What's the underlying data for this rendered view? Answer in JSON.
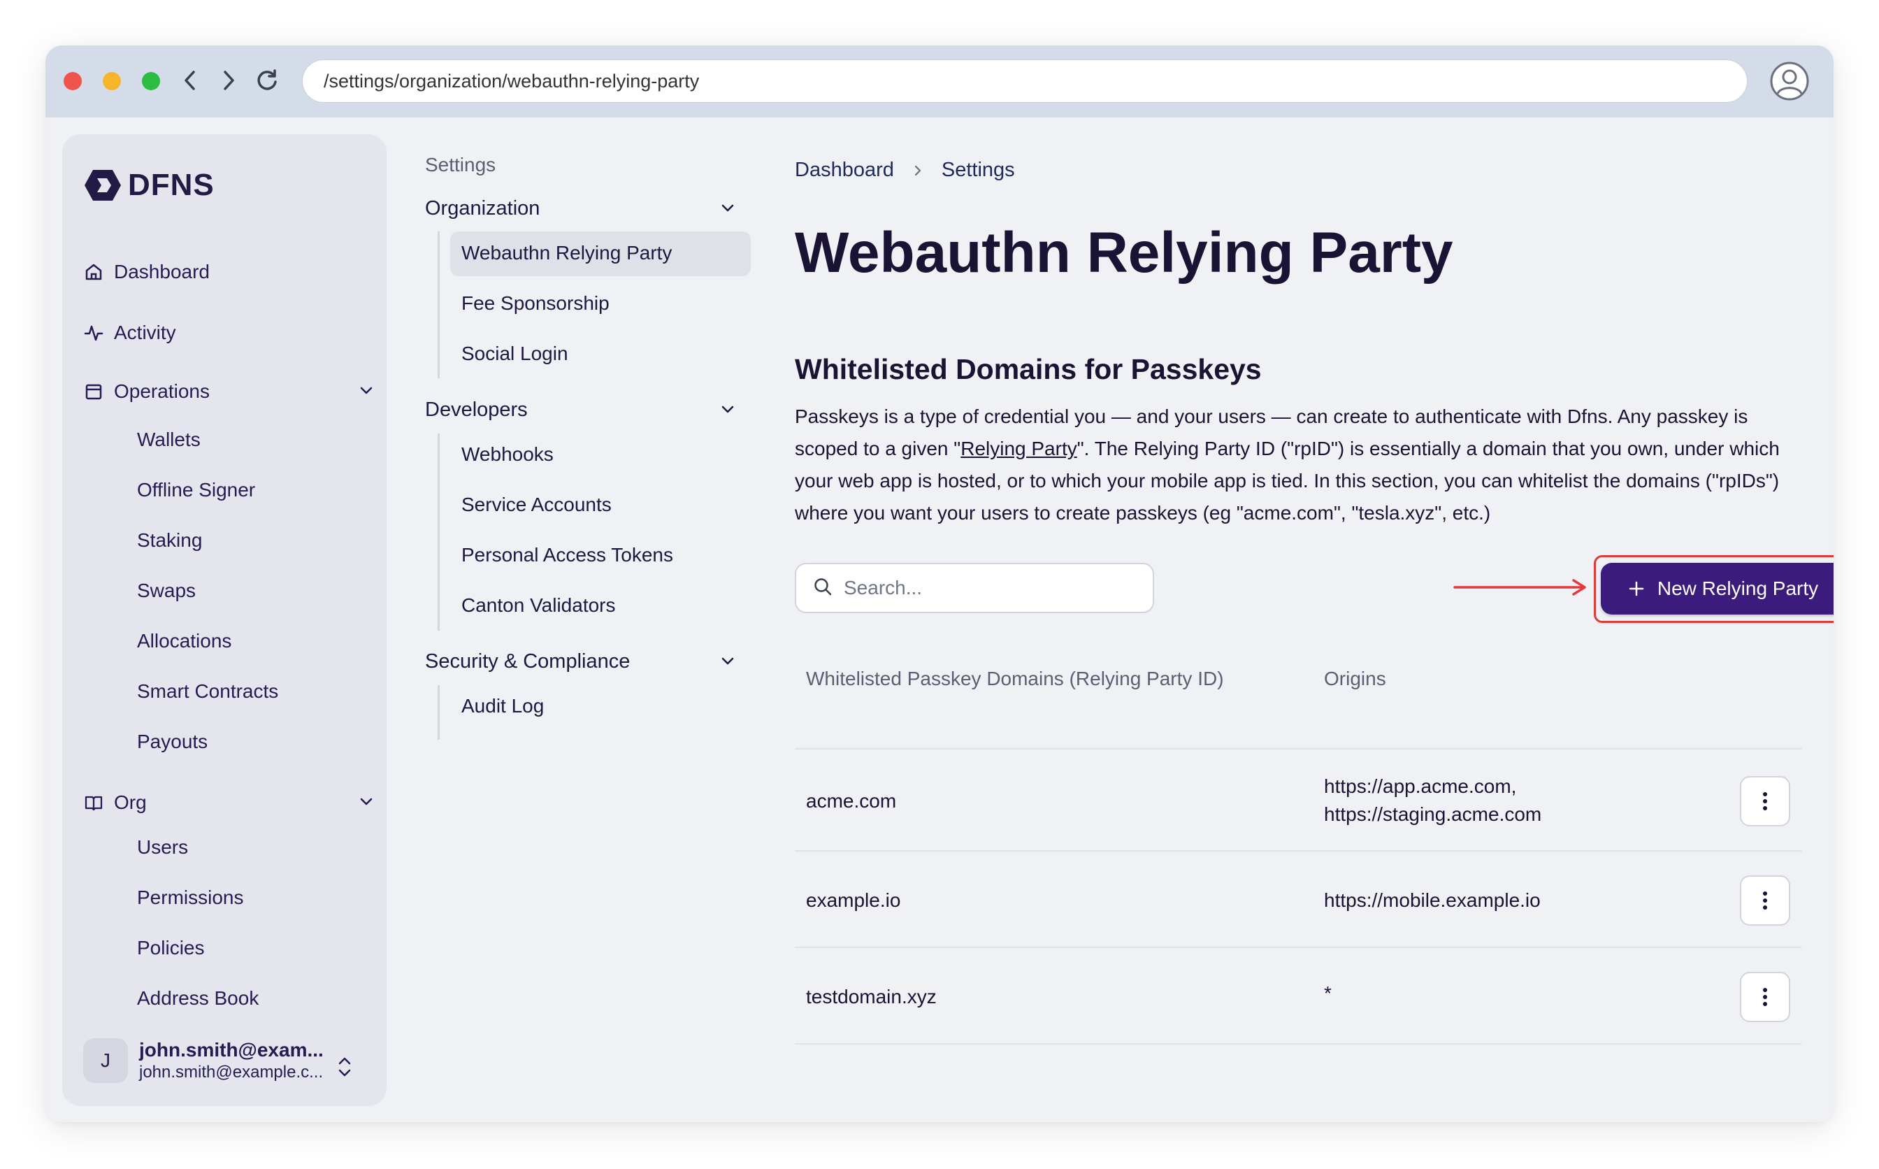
{
  "browser": {
    "url": "/settings/organization/webauthn-relying-party"
  },
  "sidebar": {
    "logo_text": "DFNS",
    "items": [
      {
        "label": "Dashboard"
      },
      {
        "label": "Activity"
      },
      {
        "label": "Operations"
      },
      {
        "label": "Org"
      }
    ],
    "operations_items": [
      "Wallets",
      "Offline Signer",
      "Staking",
      "Swaps",
      "Allocations",
      "Smart Contracts",
      "Payouts"
    ],
    "org_items": [
      "Users",
      "Permissions",
      "Policies",
      "Address Book"
    ],
    "user": {
      "initial": "J",
      "name": "john.smith@exam...",
      "email": "john.smith@example.c..."
    }
  },
  "settings_nav": {
    "title": "Settings",
    "groups": [
      {
        "label": "Organization",
        "items": [
          "Webauthn Relying Party",
          "Fee Sponsorship",
          "Social Login"
        ]
      },
      {
        "label": "Developers",
        "items": [
          "Webhooks",
          "Service Accounts",
          "Personal Access Tokens",
          "Canton Validators"
        ]
      },
      {
        "label": "Security & Compliance",
        "items": [
          "Audit Log"
        ]
      }
    ]
  },
  "main": {
    "breadcrumb": [
      "Dashboard",
      "Settings"
    ],
    "title": "Webauthn Relying Party",
    "section_title": "Whitelisted Domains for Passkeys",
    "description": {
      "part1": "Passkeys is a type of credential you — and your users — can create to authenticate with Dfns. Any passkey is scoped to a given \"",
      "link": "Relying Party",
      "part2": "\". The Relying Party ID (\"rpID\") is essentially a domain that you own, under which your web app is hosted, or to which your mobile app is tied. In this section, you can whitelist the domains (\"rpIDs\") where you want your users to create passkeys (eg \"acme.com\", \"tesla.xyz\", etc.)"
    },
    "search_placeholder": "Search...",
    "new_button_label": "New Relying Party",
    "table": {
      "columns": [
        "Whitelisted Passkey Domains (Relying Party ID)",
        "Origins"
      ],
      "rows": [
        {
          "domain": "acme.com",
          "origins": [
            "https://app.acme.com,",
            "https://staging.acme.com"
          ]
        },
        {
          "domain": "example.io",
          "origins": [
            "https://mobile.example.io"
          ]
        },
        {
          "domain": "testdomain.xyz",
          "origins": [
            "*"
          ]
        }
      ]
    }
  },
  "colors": {
    "accent": "#3b1c7c",
    "highlight": "#e23a3a",
    "text": "#1a1333"
  }
}
